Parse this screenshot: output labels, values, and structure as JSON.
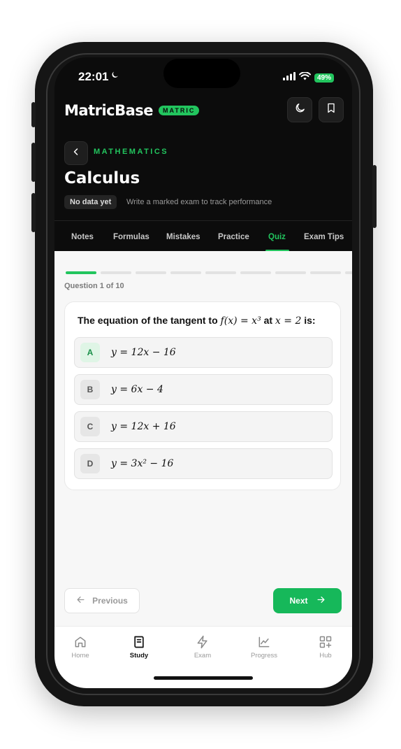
{
  "status": {
    "time": "22:01",
    "battery": "49%"
  },
  "brand": {
    "name": "MatricBase",
    "badge": "MATRIC"
  },
  "header": {
    "subject": "MATHEMATICS",
    "topic": "Calculus",
    "data_badge": "No data yet",
    "data_hint": "Write a marked exam to track performance"
  },
  "tabs": [
    {
      "label": "Notes"
    },
    {
      "label": "Formulas"
    },
    {
      "label": "Mistakes"
    },
    {
      "label": "Practice"
    },
    {
      "label": "Quiz",
      "active": true
    },
    {
      "label": "Exam Tips"
    }
  ],
  "quiz": {
    "progress": {
      "current": 1,
      "total": 10
    },
    "counter": "Question 1 of 10",
    "question": {
      "pre": "The equation of the tangent to ",
      "func": "f(x) = x³",
      "mid": " at ",
      "point": "x = 2",
      "post": " is:"
    },
    "options": [
      {
        "letter": "A",
        "text": "y = 12x − 16"
      },
      {
        "letter": "B",
        "text": "y = 6x − 4"
      },
      {
        "letter": "C",
        "text": "y = 12x + 16"
      },
      {
        "letter": "D",
        "text": "y = 3x² − 16"
      }
    ],
    "prev_label": "Previous",
    "next_label": "Next"
  },
  "nav": [
    {
      "label": "Home",
      "icon": "home-icon"
    },
    {
      "label": "Study",
      "icon": "book-icon",
      "active": true
    },
    {
      "label": "Exam",
      "icon": "lightning-icon"
    },
    {
      "label": "Progress",
      "icon": "chart-icon"
    },
    {
      "label": "Hub",
      "icon": "grid-plus-icon"
    }
  ],
  "colors": {
    "accent": "#22c55e",
    "dark_bg": "#0c0c0c",
    "next_button": "#16b85a"
  }
}
